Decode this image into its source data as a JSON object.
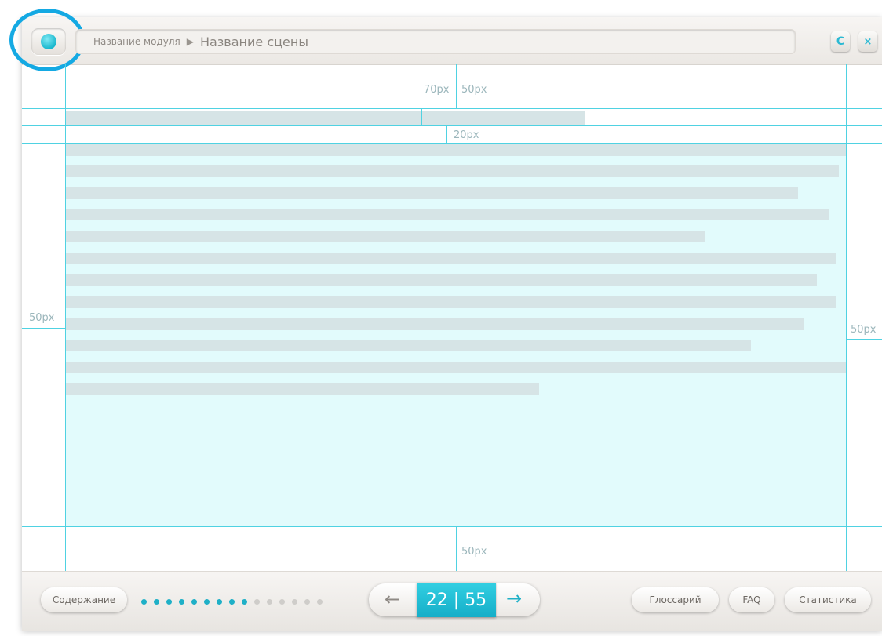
{
  "header": {
    "module_name": "Название модуля",
    "arrow": "▶",
    "scene_name": "Название сцены",
    "refresh_icon": "C",
    "close_icon": "×"
  },
  "guides": {
    "label_70": "70px",
    "label_50_top": "50px",
    "label_20": "20px",
    "label_50_left": "50px",
    "label_50_right": "50px",
    "label_50_bottom": "50px"
  },
  "footer": {
    "contents_label": "Содержание",
    "counter": "22 | 55",
    "prev_icon": "←",
    "next_icon": "→",
    "glossary_label": "Глоссарий",
    "faq_label": "FAQ",
    "stats_label": "Статистика"
  },
  "progress": {
    "done": 9,
    "total": 15
  },
  "colors": {
    "accent": "#1fb0c7",
    "highlight": "#14a9e3",
    "content_bg": "#e2fbfc",
    "guide": "#4fd2e2"
  }
}
